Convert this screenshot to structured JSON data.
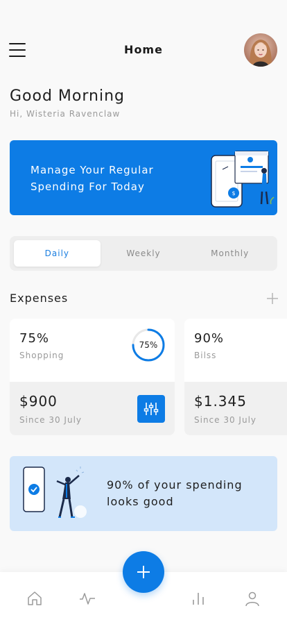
{
  "header": {
    "title": "Home",
    "menu_icon": "hamburger-menu-icon",
    "avatar_icon": "user-avatar"
  },
  "greeting": {
    "title": "Good Morning",
    "subtitle": "Hi, Wisteria Ravenclaw"
  },
  "banner": {
    "text": "Manage Your Regular Spending For Today",
    "color": "#0d7ce5"
  },
  "period_tabs": {
    "items": [
      "Daily",
      "Weekly",
      "Monthly"
    ],
    "selected": "Daily"
  },
  "expenses": {
    "title": "Expenses",
    "add_icon": "plus-icon",
    "cards": [
      {
        "percent": "75%",
        "category": "Shopping",
        "ring_label": "75%",
        "ring_value": 0.75,
        "amount": "$900",
        "since": "Since 30 July",
        "action_icon": "sliders-icon"
      },
      {
        "percent": "90%",
        "category": "Bilss",
        "amount": "$1.345",
        "since": "Since 30 July"
      }
    ]
  },
  "tip": {
    "text": "90% of your spending looks good",
    "color": "#d3e6fa"
  },
  "tabbar": {
    "items": [
      "home-icon",
      "activity-icon",
      "plus-icon",
      "bar-chart-icon",
      "profile-icon"
    ],
    "accent": "#0d7ce5"
  }
}
